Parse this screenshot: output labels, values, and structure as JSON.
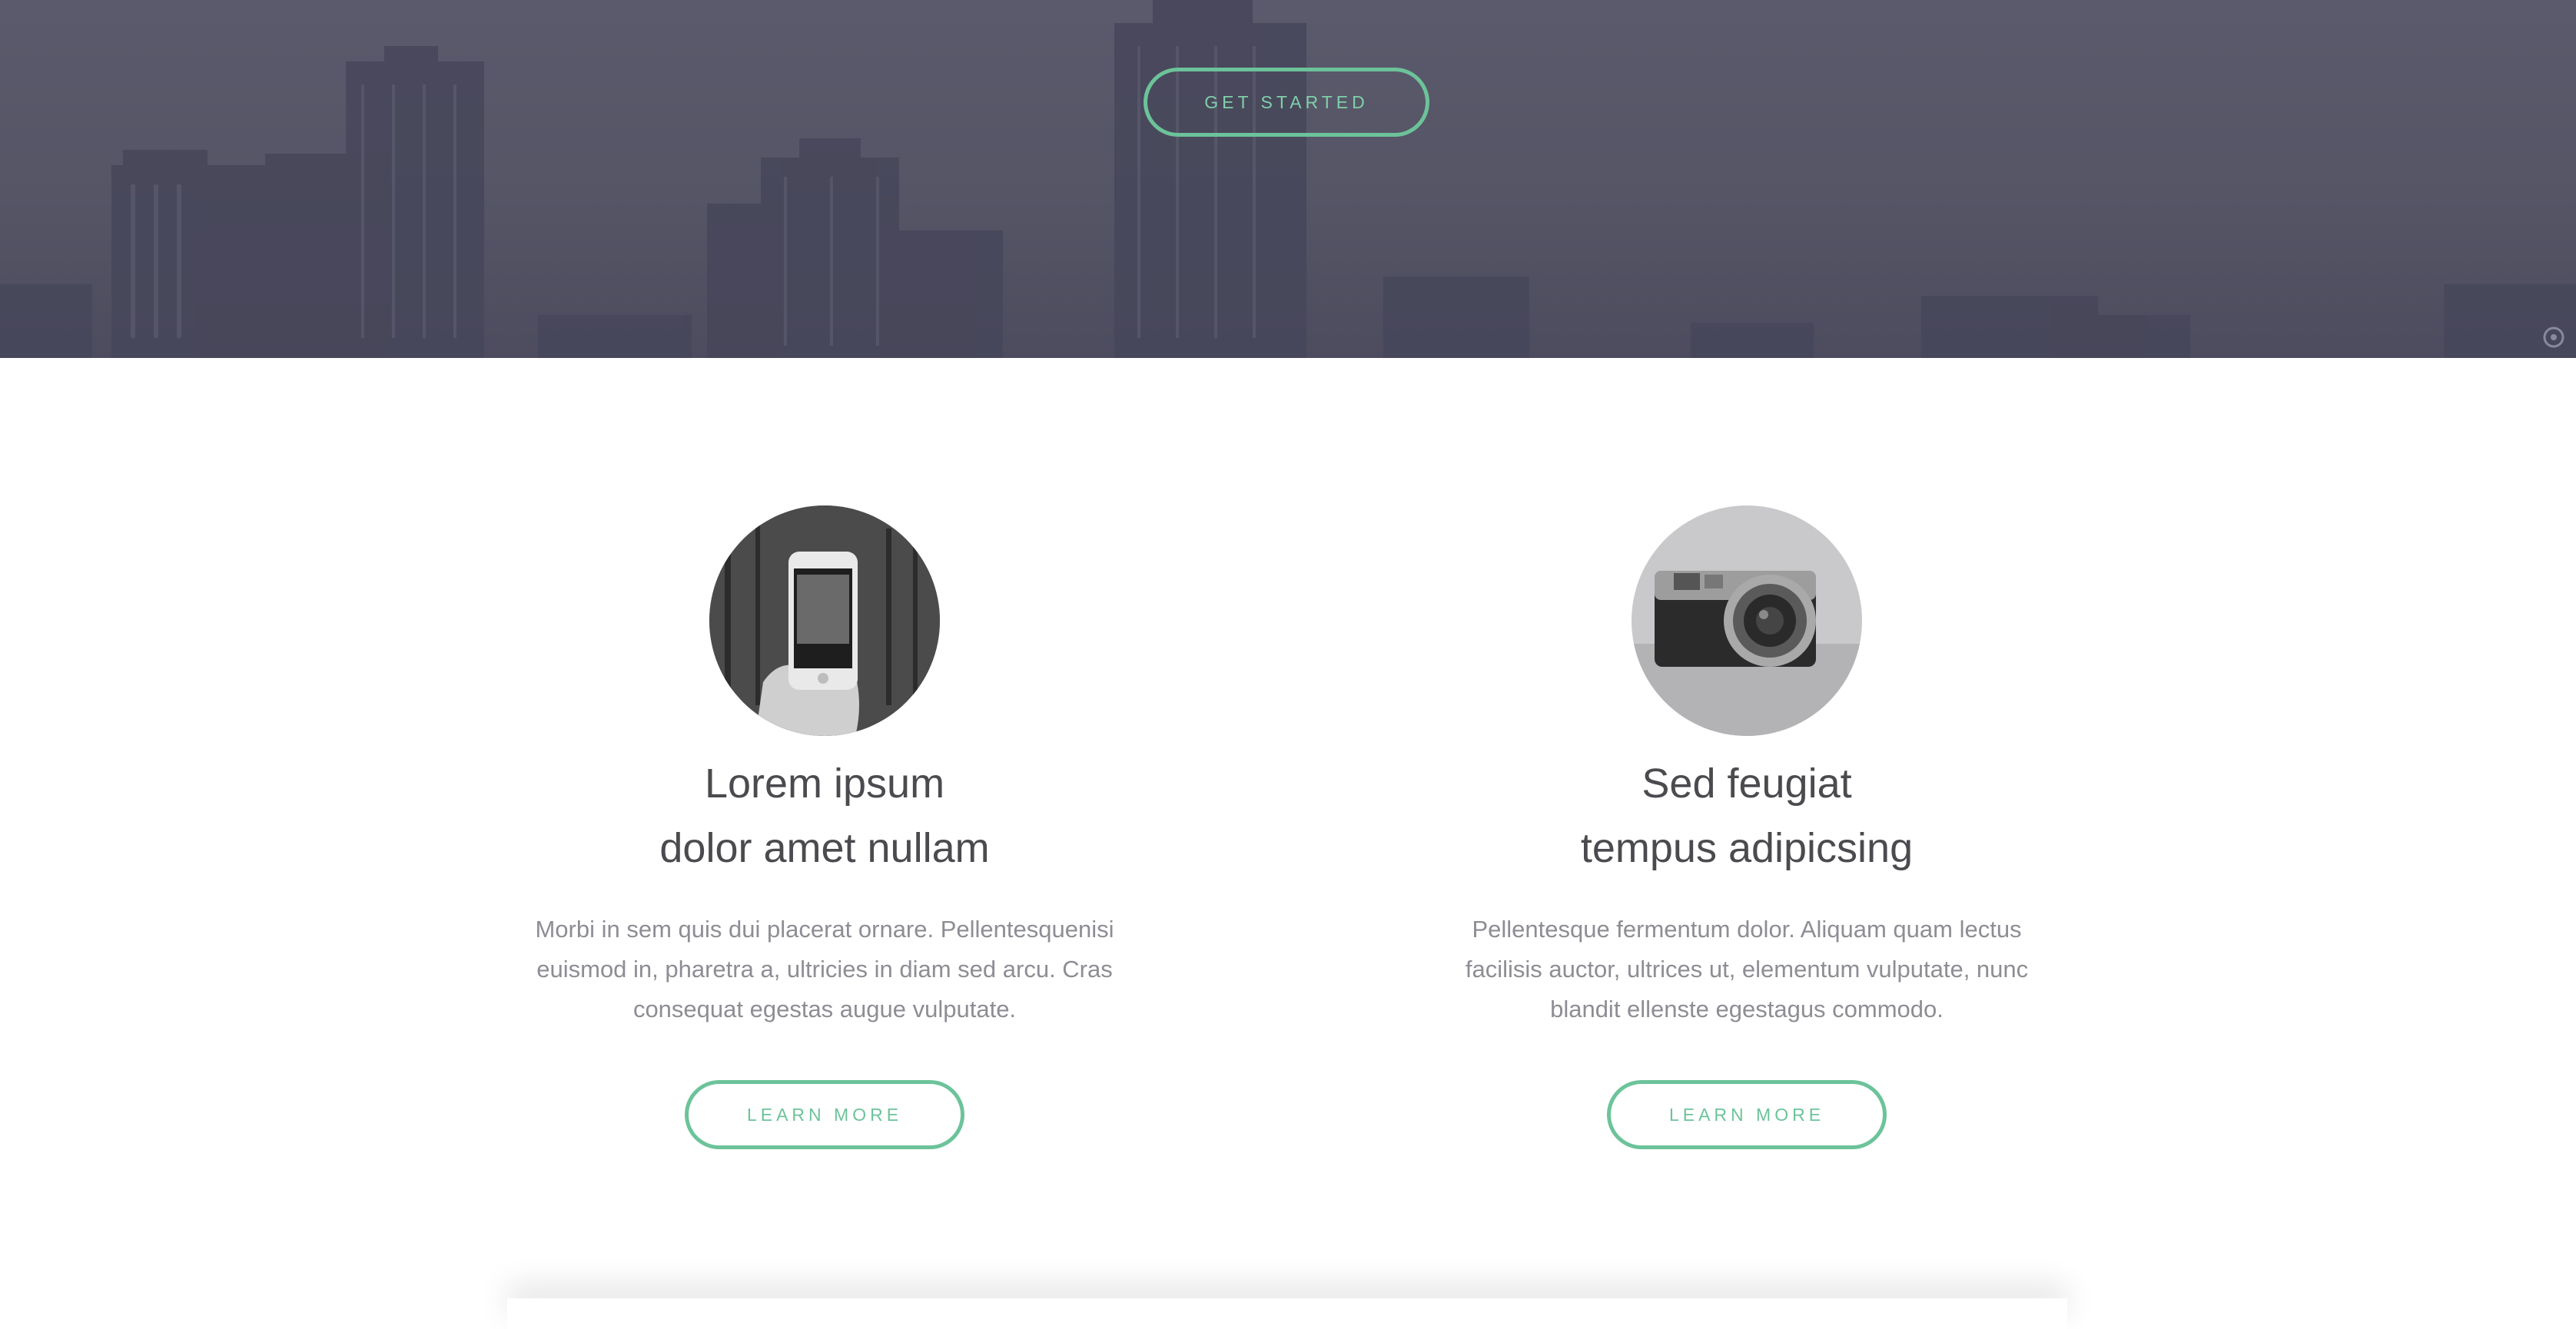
{
  "hero": {
    "cta_label": "GET STARTED",
    "overlay_color": "#555566",
    "badge_icon": "circle-logo-icon"
  },
  "features": [
    {
      "image_icon": "phone-in-hand-photo",
      "title_line1": "Lorem ipsum",
      "title_line2": "dolor amet nullam",
      "description": "Morbi in sem quis dui placerat ornare. Pellentesquenisi euismod in, pharetra a, ultricies in diam sed arcu. Cras consequat egestas augue vulputate.",
      "button_label": "LEARN MORE"
    },
    {
      "image_icon": "vintage-camera-photo",
      "title_line1": "Sed feugiat",
      "title_line2": "tempus adipicsing",
      "description": "Pellentesque fermentum dolor. Aliquam quam lectus facilisis auctor, ultrices ut, elementum vulputate, nunc blandit ellenste egestagus commodo.",
      "button_label": "LEARN MORE"
    }
  ],
  "colors": {
    "accent": "#6cc39a",
    "heading": "#4b4b4f",
    "body_text": "#8d8d94"
  }
}
